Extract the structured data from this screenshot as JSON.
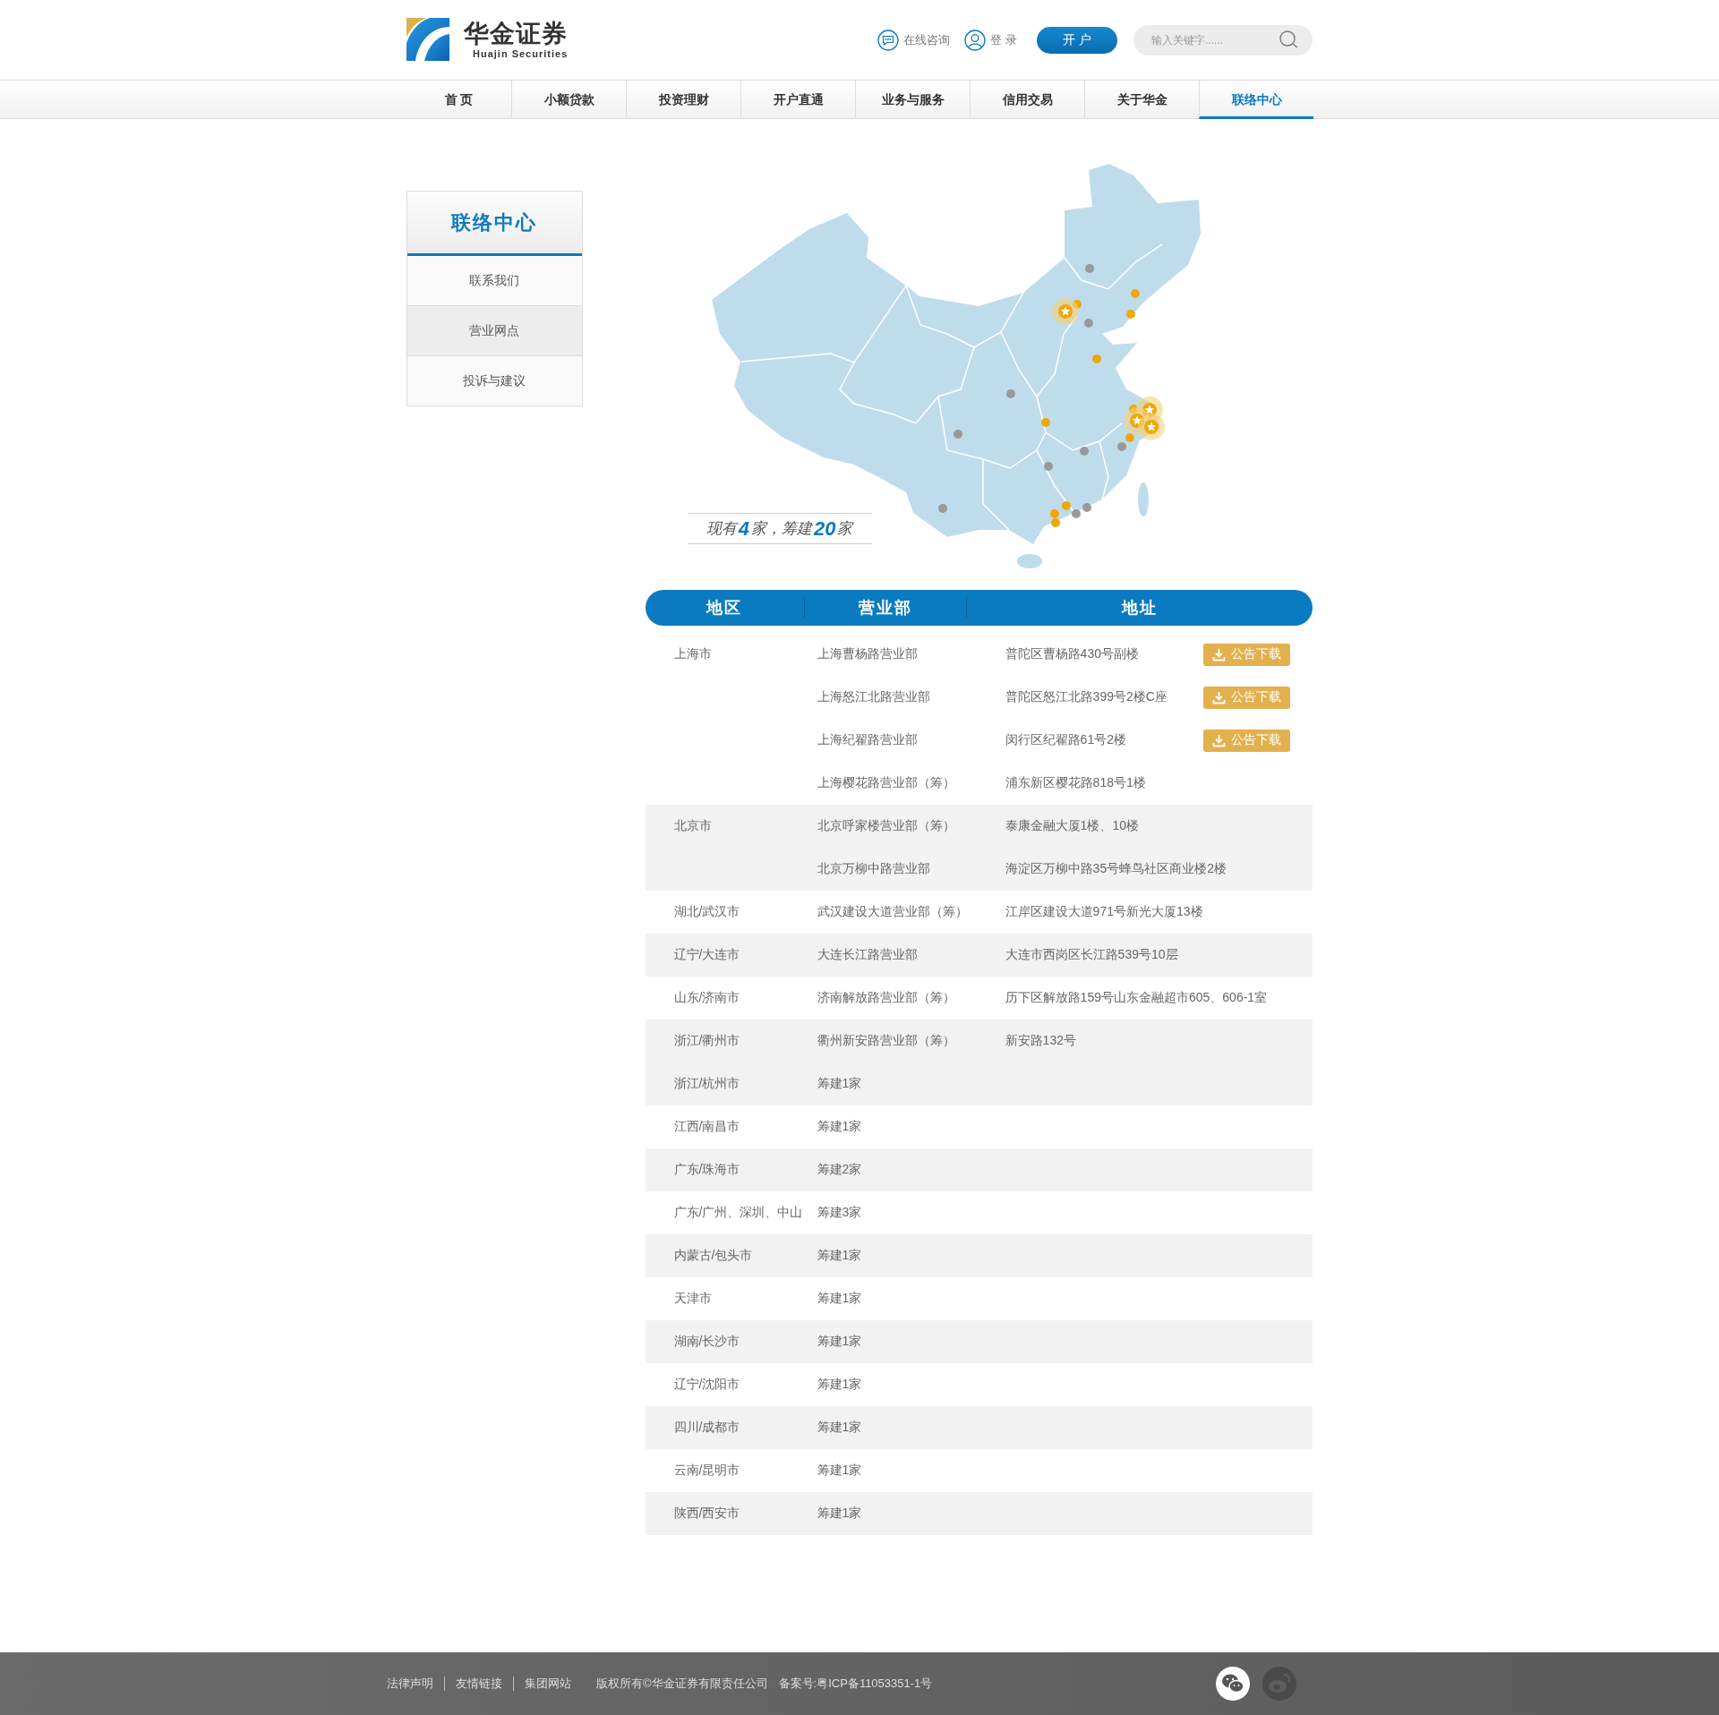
{
  "header": {
    "logo": {
      "name": "华金证券",
      "subtitle": "Huajin Securities"
    },
    "links": [
      {
        "kind": "chat",
        "label": "在线咨询"
      },
      {
        "kind": "user",
        "label": "登 录"
      }
    ],
    "open_account": "开 户",
    "search": {
      "placeholder": "输入关键字......"
    }
  },
  "nav": [
    {
      "label": "首 页",
      "selected": false
    },
    {
      "label": "小额贷款",
      "selected": false
    },
    {
      "label": "投资理财",
      "selected": false
    },
    {
      "label": "开户直通",
      "selected": false
    },
    {
      "label": "业务与服务",
      "selected": false
    },
    {
      "label": "信用交易",
      "selected": false
    },
    {
      "label": "关于华金",
      "selected": false
    },
    {
      "label": "联络中心",
      "selected": true
    }
  ],
  "sidebar": {
    "title": "联络中心",
    "items": [
      {
        "label": "联系我们",
        "selected": false
      },
      {
        "label": "营业网点",
        "selected": true
      },
      {
        "label": "投诉与建议",
        "selected": false
      }
    ]
  },
  "map": {
    "caption": "现有**4**家，筹建**20**家"
  },
  "table": {
    "columns": [
      "地区",
      "营业部",
      "地址"
    ],
    "groups": [
      {
        "region": "上海市",
        "shaded": false,
        "branches": [
          {
            "name": "上海曹杨路营业部",
            "address": "普陀区曹杨路430号副楼",
            "download": "公告下载"
          },
          {
            "name": "上海怒江北路营业部",
            "address": "普陀区怒江北路399号2楼C座",
            "download": "公告下载"
          },
          {
            "name": "上海纪翟路营业部",
            "address": "闵行区纪翟路61号2楼",
            "download": "公告下载"
          },
          {
            "name": "上海樱花路营业部（筹）",
            "address": "浦东新区樱花路818号1楼"
          }
        ]
      },
      {
        "region": "北京市",
        "shaded": true,
        "branches": [
          {
            "name": "北京呼家楼营业部（筹）",
            "address": "泰康金融大厦1楼、10楼"
          },
          {
            "name": "北京万柳中路营业部",
            "address": "海淀区万柳中路35号蜂鸟社区商业楼2楼"
          }
        ]
      },
      {
        "region": "湖北/武汉市",
        "shaded": false,
        "branches": [
          {
            "name": "武汉建设大道营业部（筹）",
            "address": "江岸区建设大道971号新光大厦13楼"
          }
        ]
      },
      {
        "region": "辽宁/大连市",
        "shaded": true,
        "branches": [
          {
            "name": "大连长江路营业部",
            "address": "大连市西岗区长江路539号10层"
          }
        ]
      },
      {
        "region": "山东/济南市",
        "shaded": false,
        "branches": [
          {
            "name": "济南解放路营业部（筹）",
            "address": "历下区解放路159号山东金融超市605、606-1室"
          }
        ]
      },
      {
        "region": "浙江/衢州市",
        "shaded": true,
        "branches": [
          {
            "name": "衢州新安路营业部（筹）",
            "address": "新安路132号"
          }
        ]
      },
      {
        "region": "浙江/杭州市",
        "shaded": true,
        "branches": [
          {
            "name": "筹建1家"
          }
        ]
      },
      {
        "region": "江西/南昌市",
        "shaded": false,
        "branches": [
          {
            "name": "筹建1家"
          }
        ]
      },
      {
        "region": "广东/珠海市",
        "shaded": true,
        "branches": [
          {
            "name": "筹建2家"
          }
        ]
      },
      {
        "region": "广东/广州、深圳、中山",
        "shaded": false,
        "branches": [
          {
            "name": "筹建3家"
          }
        ]
      },
      {
        "region": "内蒙古/包头市",
        "shaded": true,
        "branches": [
          {
            "name": "筹建1家"
          }
        ]
      },
      {
        "region": "天津市",
        "shaded": false,
        "branches": [
          {
            "name": "筹建1家"
          }
        ]
      },
      {
        "region": "湖南/长沙市",
        "shaded": true,
        "branches": [
          {
            "name": "筹建1家"
          }
        ]
      },
      {
        "region": "辽宁/沈阳市",
        "shaded": false,
        "branches": [
          {
            "name": "筹建1家"
          }
        ]
      },
      {
        "region": "四川/成都市",
        "shaded": true,
        "branches": [
          {
            "name": "筹建1家"
          }
        ]
      },
      {
        "region": "云南/昆明市",
        "shaded": false,
        "branches": [
          {
            "name": "筹建1家"
          }
        ]
      },
      {
        "region": "陕西/西安市",
        "shaded": true,
        "branches": [
          {
            "name": "筹建1家"
          }
        ]
      }
    ]
  },
  "footer": {
    "links": [
      "法律声明",
      "友情链接",
      "集团网站"
    ],
    "copyright": "版权所有©华金证券有限责任公司",
    "icp": "备案号:粤ICP备11053351-1号",
    "social": [
      {
        "kind": "wechat"
      },
      {
        "kind": "weibo"
      }
    ]
  }
}
